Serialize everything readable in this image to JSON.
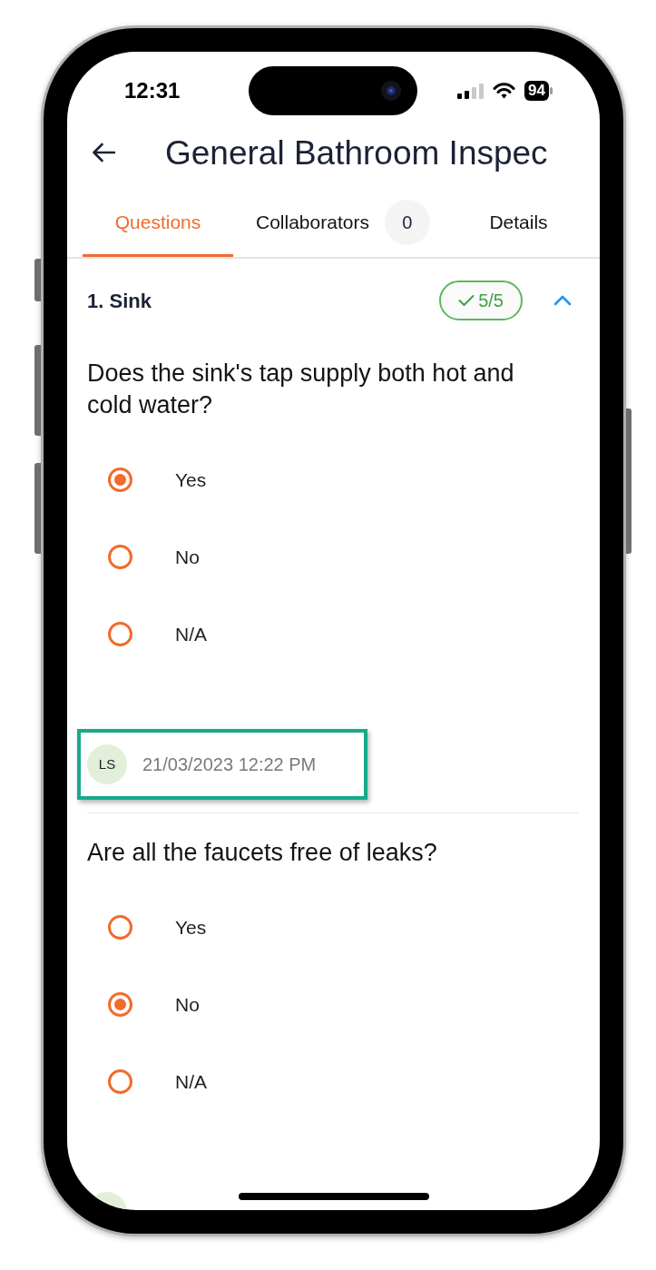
{
  "status_bar": {
    "time": "12:31",
    "battery": "94"
  },
  "header": {
    "title": "General Bathroom Inspec"
  },
  "tabs": [
    {
      "label": "Questions",
      "selected": true
    },
    {
      "label": "Collaborators",
      "selected": false,
      "count": "0"
    },
    {
      "label": "Details",
      "selected": false
    }
  ],
  "section": {
    "title": "1. Sink",
    "progress": "5/5",
    "complete": true,
    "expanded": true
  },
  "questions": [
    {
      "text": "Does the sink's tap supply both hot and cold water?",
      "options": [
        {
          "label": "Yes",
          "selected": true
        },
        {
          "label": "No",
          "selected": false
        },
        {
          "label": "N/A",
          "selected": false
        }
      ],
      "answered_by": {
        "initials": "LS",
        "timestamp": "21/03/2023 12:22 PM",
        "highlighted": true
      }
    },
    {
      "text": "Are all the faucets free of leaks?",
      "options": [
        {
          "label": "Yes",
          "selected": false
        },
        {
          "label": "No",
          "selected": true
        },
        {
          "label": "N/A",
          "selected": false
        }
      ],
      "answered_by": {
        "highlighted": false
      }
    }
  ]
}
